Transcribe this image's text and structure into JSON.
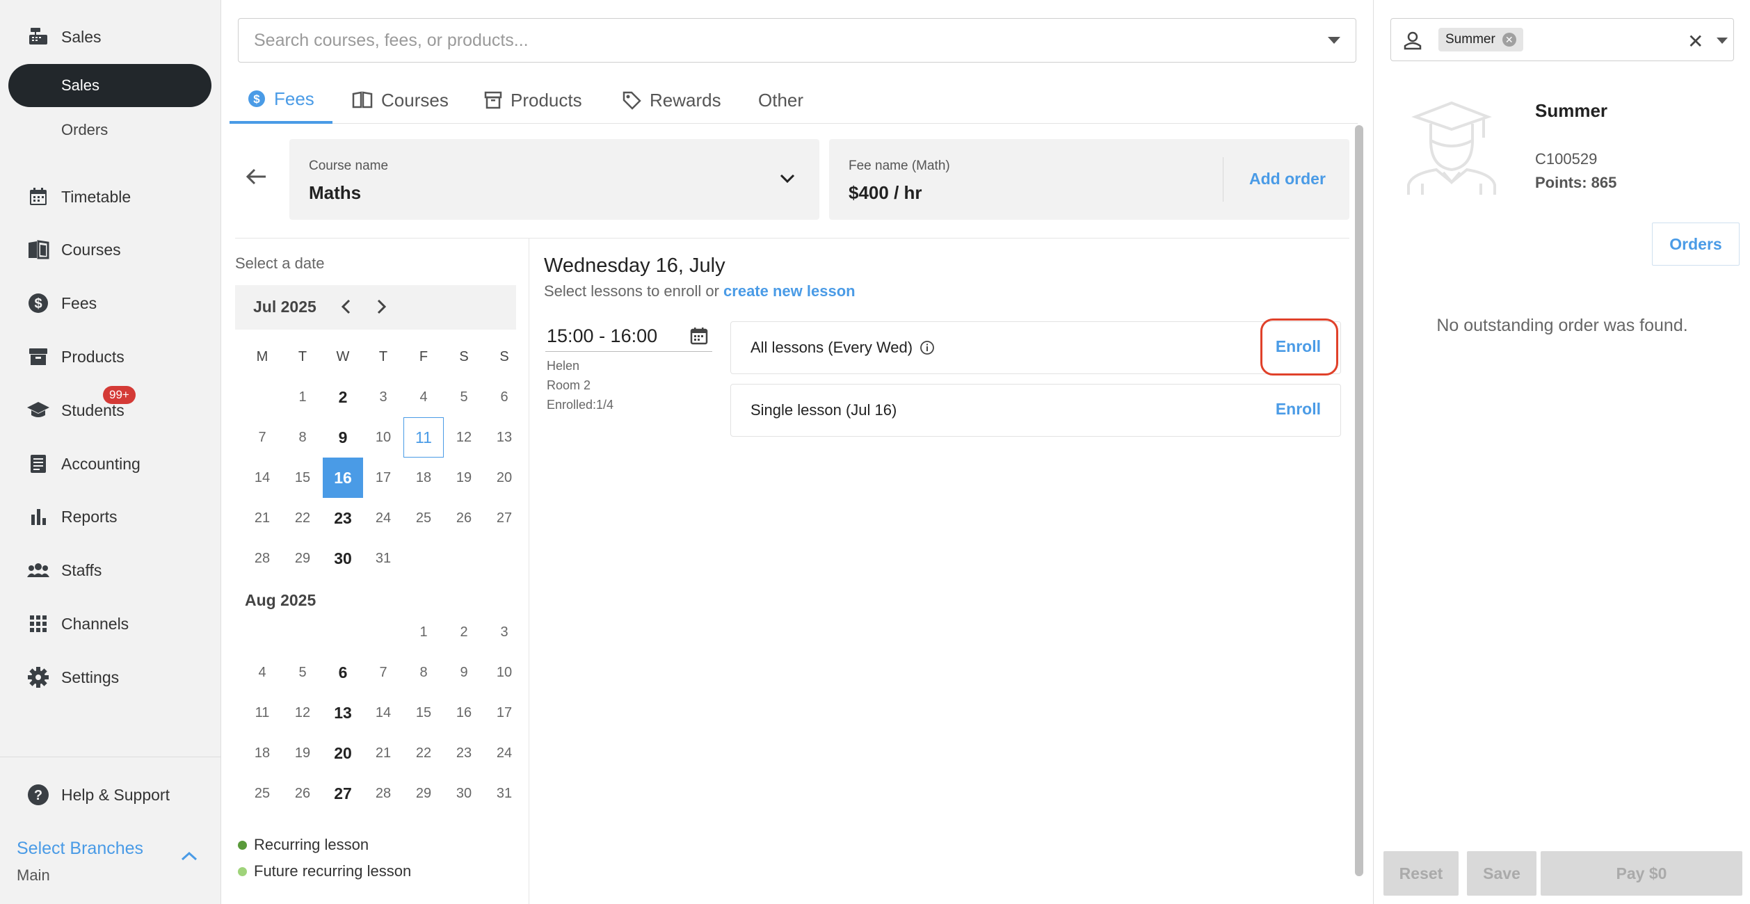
{
  "sidebar": {
    "sales_header": "Sales",
    "sales_sub": "Sales",
    "orders_sub": "Orders",
    "items": [
      {
        "label": "Timetable",
        "icon": "calendar-icon"
      },
      {
        "label": "Courses",
        "icon": "book-icon"
      },
      {
        "label": "Fees",
        "icon": "dollar-icon"
      },
      {
        "label": "Products",
        "icon": "archive-icon"
      },
      {
        "label": "Students",
        "icon": "graduation-cap-icon"
      },
      {
        "label": "Accounting",
        "icon": "ledger-icon"
      },
      {
        "label": "Reports",
        "icon": "bar-chart-icon"
      },
      {
        "label": "Staffs",
        "icon": "people-icon"
      },
      {
        "label": "Channels",
        "icon": "grid-icon"
      },
      {
        "label": "Settings",
        "icon": "gear-icon"
      }
    ],
    "students_badge": "99+",
    "help": "Help & Support",
    "branch_title": "Select Branches",
    "branch_value": "Main"
  },
  "search": {
    "placeholder": "Search courses, fees, or products..."
  },
  "tabs": [
    {
      "label": "Fees"
    },
    {
      "label": "Courses"
    },
    {
      "label": "Products"
    },
    {
      "label": "Rewards"
    },
    {
      "label": "Other"
    }
  ],
  "course": {
    "label": "Course name",
    "value": "Maths"
  },
  "fee": {
    "label": "Fee name (Math)",
    "value": "$400 / hr",
    "add_order": "Add order"
  },
  "calendar": {
    "select_date": "Select a date",
    "month1": "Jul 2025",
    "month2": "Aug 2025",
    "weekdays": [
      "M",
      "T",
      "W",
      "T",
      "F",
      "S",
      "S"
    ],
    "legend": [
      {
        "label": "Recurring lesson",
        "color": "#5a9a3a"
      },
      {
        "label": "Future recurring lesson",
        "color": "#9fd37a"
      }
    ]
  },
  "lessons": {
    "day_title": "Wednesday 16, July",
    "sub_prefix": "Select lessons to enroll or ",
    "sub_link": "create new lesson",
    "time": "15:00 - 16:00",
    "teacher": "Helen",
    "room": "Room 2",
    "enrolled": "Enrolled:1/4",
    "cards": [
      {
        "name": "All lessons (Every Wed)",
        "action": "Enroll"
      },
      {
        "name": "Single lesson (Jul 16)",
        "action": "Enroll"
      }
    ]
  },
  "customer": {
    "chip": "Summer",
    "name": "Summer",
    "id": "C100529",
    "points": "Points: 865",
    "orders_button": "Orders",
    "no_order": "No outstanding order was found."
  },
  "footer": {
    "reset": "Reset",
    "save": "Save",
    "pay": "Pay $0"
  },
  "colors": {
    "accent": "#4a9be6",
    "dark": "#22272b",
    "highlight": "#e0412a"
  }
}
